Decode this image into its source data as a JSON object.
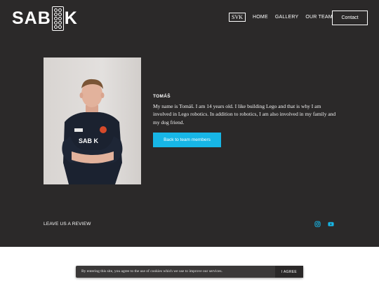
{
  "brand": {
    "text_left": "SAB",
    "text_right": "K"
  },
  "header": {
    "language": "SVK",
    "nav": [
      "HOME",
      "GALLERY",
      "OUR TEAM"
    ],
    "contact": "Contact"
  },
  "member": {
    "name": "TOMÁŠ",
    "bio": "My name is Tomáš. I am 14 years old. I like building Lego and that is why I am involved in Lego robotics. In addition to robotics, I am also involved in my family and my dog friend.",
    "back_button": "Back to team members",
    "jersey_text": "SAB K"
  },
  "footer": {
    "review": "LEAVE US A REVIEW",
    "social_icons": [
      "instagram-icon",
      "youtube-icon"
    ],
    "accent": "#17b6e6"
  },
  "cookie": {
    "text": "By entering this site, you agree to the use of cookies which we use to improve our services.",
    "agree": "I AGREE"
  }
}
